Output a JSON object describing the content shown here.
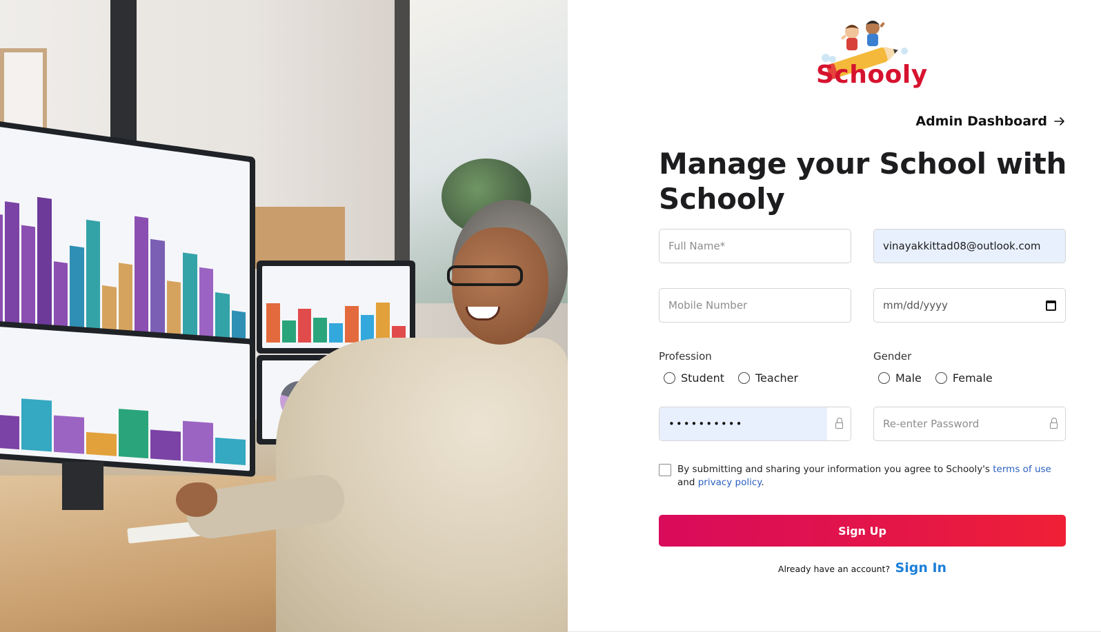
{
  "brand": {
    "name": "Schooly",
    "color": "#d6132e"
  },
  "nav": {
    "admin_link_label": "Admin Dashboard",
    "admin_link_icon": "arrow-right-icon"
  },
  "heading": "Manage your School with Schooly",
  "form": {
    "full_name": {
      "placeholder": "Full Name*",
      "value": ""
    },
    "email": {
      "placeholder": "",
      "value": "vinayakkittad08@outlook.com"
    },
    "mobile": {
      "placeholder": "Mobile Number",
      "value": ""
    },
    "dob": {
      "placeholder": "mm/dd/yyyy"
    },
    "profession": {
      "label": "Profession",
      "options": [
        "Student",
        "Teacher"
      ]
    },
    "gender": {
      "label": "Gender",
      "options": [
        "Male",
        "Female"
      ]
    },
    "password": {
      "masked_value": "••••••••••",
      "icon": "lock-icon"
    },
    "confirm_password": {
      "placeholder": "Re-enter Password",
      "icon": "lock-icon"
    },
    "consent": {
      "text_before": "By submitting and sharing your information you agree to Schooly's ",
      "terms_link": "terms of use",
      "text_middle": " and ",
      "privacy_link": "privacy policy",
      "text_after": "."
    },
    "submit_label": "Sign Up",
    "submit_colors": [
      "#d90b5b",
      "#ef2036"
    ]
  },
  "signin": {
    "question": "Already have an account?",
    "link_label": "Sign In",
    "link_color": "#1c7fd8"
  }
}
